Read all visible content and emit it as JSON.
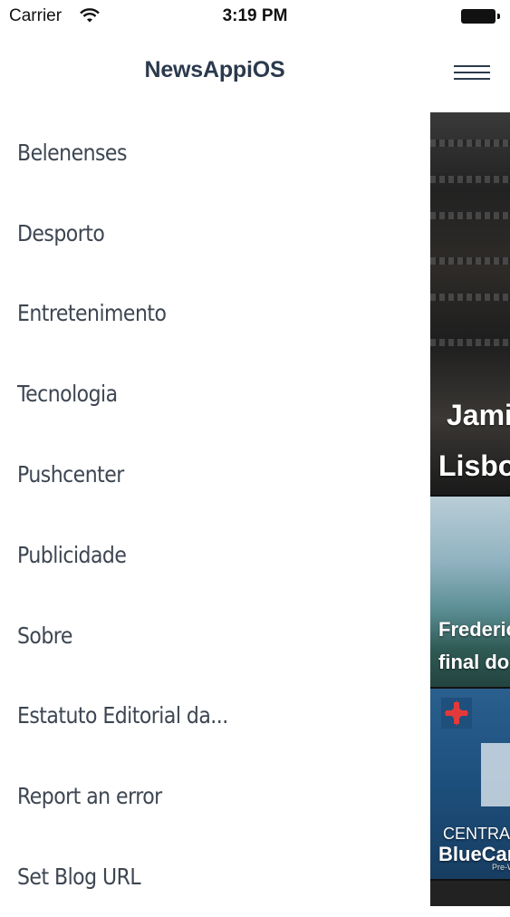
{
  "status_bar": {
    "carrier": "Carrier",
    "time": "3:19 PM"
  },
  "nav": {
    "title": "NewsAppiOS"
  },
  "menu": {
    "items": [
      {
        "label": "Belenenses"
      },
      {
        "label": "Desporto"
      },
      {
        "label": "Entretenimento"
      },
      {
        "label": "Tecnologia"
      },
      {
        "label": "Pushcenter"
      },
      {
        "label": "Publicidade"
      },
      {
        "label": "Sobre"
      },
      {
        "label": "Estatuto Editorial da..."
      },
      {
        "label": "Report an error"
      },
      {
        "label": "Set Blog URL"
      }
    ]
  },
  "news": {
    "cards": [
      {
        "line1": "Jami",
        "line2": "Lisbo"
      },
      {
        "line1": "Frederic",
        "line2": "final do"
      },
      {
        "line1": "CENTRAL:",
        "line2": "BlueCar",
        "line3": "Pre-W"
      }
    ]
  },
  "colors": {
    "title": "#2b3a4d",
    "menu_text": "#3d4652",
    "background": "#ffffff"
  },
  "icons": [
    "wifi-icon",
    "battery-icon",
    "hamburger-menu-icon",
    "cross-icon"
  ]
}
